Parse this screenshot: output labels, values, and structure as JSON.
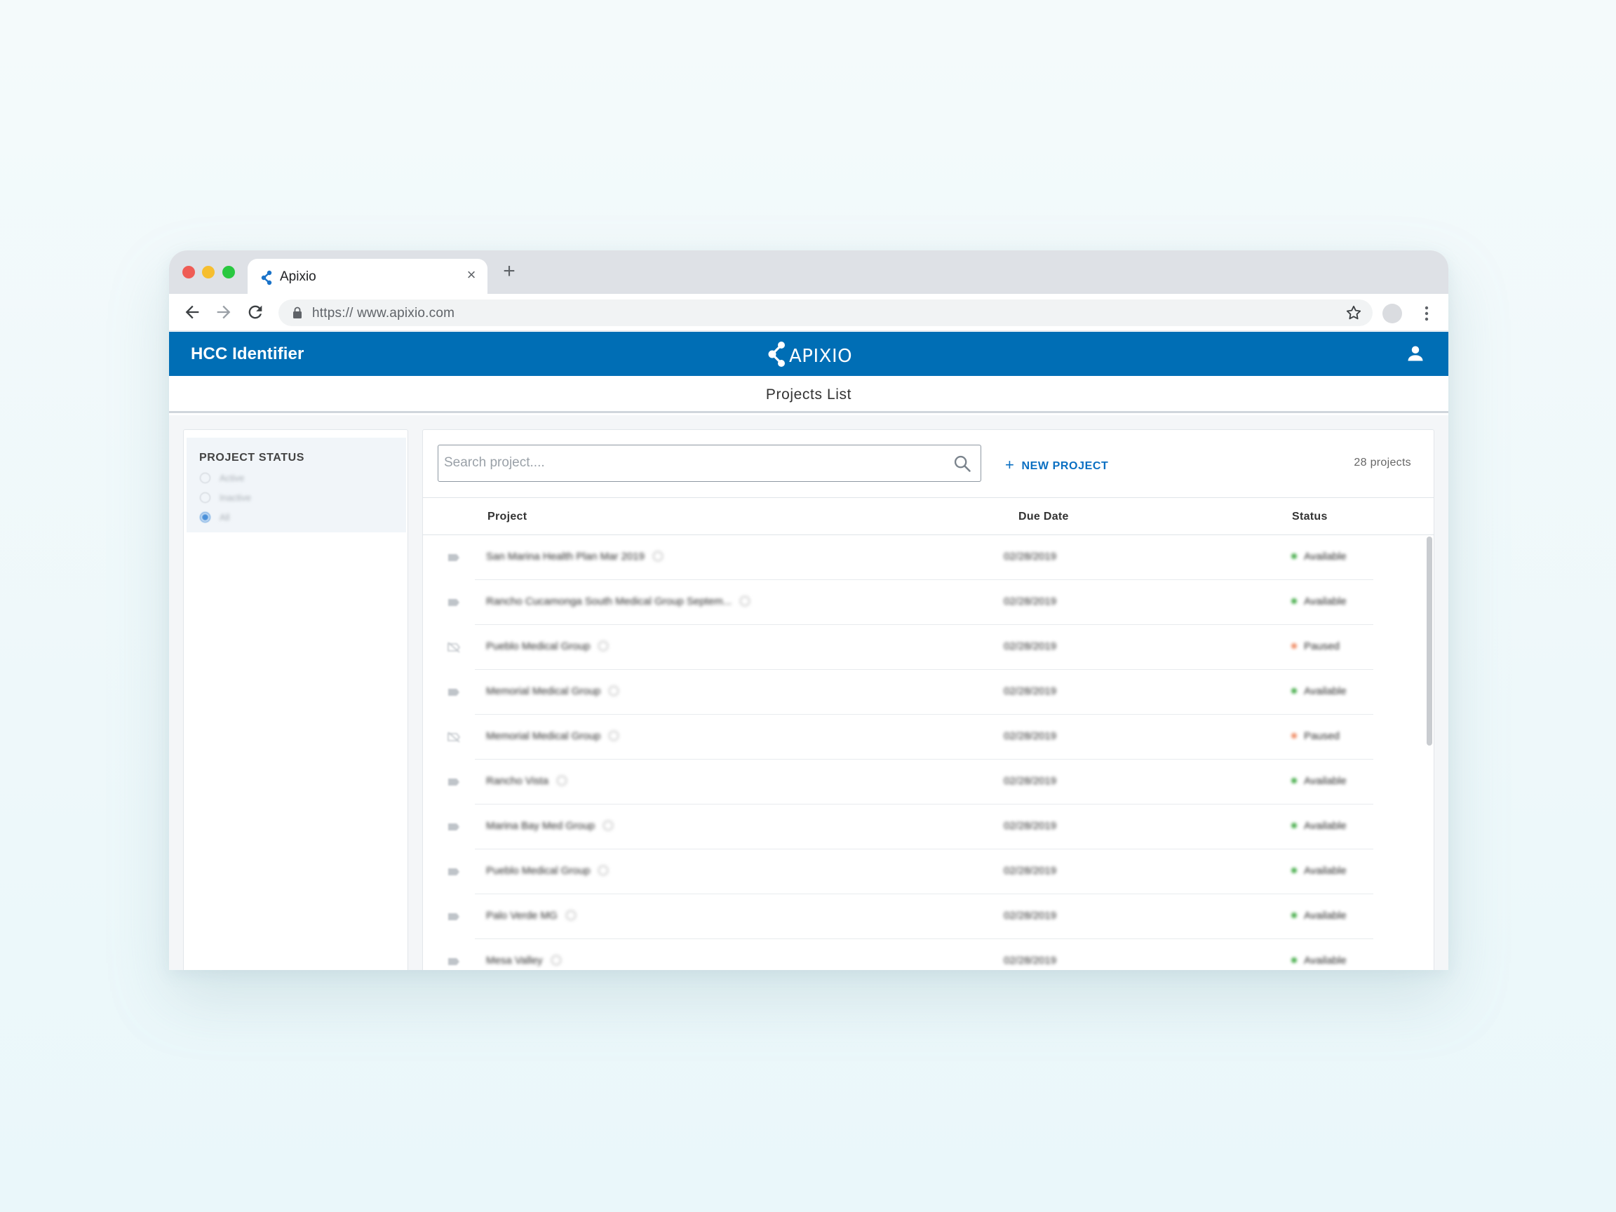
{
  "browser": {
    "tab_title": "Apixio",
    "tab_close": "×",
    "new_tab": "+",
    "url": "https:// www.apixio.com"
  },
  "app": {
    "name": "HCC Identifier",
    "logo_text": "APIXIO",
    "page_title": "Projects List"
  },
  "filters": {
    "heading": "PROJECT STATUS",
    "options": [
      {
        "label": "Active",
        "checked": false
      },
      {
        "label": "Inactive",
        "checked": false
      },
      {
        "label": "All",
        "checked": true
      }
    ]
  },
  "search": {
    "placeholder": "Search project...."
  },
  "actions": {
    "new_project_icon": "+",
    "new_project_label": "NEW PROJECT"
  },
  "project_count": "28 projects",
  "table": {
    "columns": [
      "Project",
      "Due Date",
      "Status"
    ],
    "rows": [
      {
        "name": "San Marina Health Plan Mar 2019",
        "due": "02/28/2019",
        "status": "Available",
        "icon": "tag-icon"
      },
      {
        "name": "Rancho Cucamonga South Medical Group Septem...",
        "due": "02/28/2019",
        "status": "Available",
        "icon": "tag-icon"
      },
      {
        "name": "Pueblo Medical Group",
        "due": "02/28/2019",
        "status": "Paused",
        "icon": "tag-off-icon"
      },
      {
        "name": "Memorial Medical Group",
        "due": "02/28/2019",
        "status": "Available",
        "icon": "tag-icon"
      },
      {
        "name": "Memorial Medical Group",
        "due": "02/28/2019",
        "status": "Paused",
        "icon": "tag-off-icon"
      },
      {
        "name": "Rancho Vista",
        "due": "02/28/2019",
        "status": "Available",
        "icon": "tag-icon"
      },
      {
        "name": "Marina Bay Med Group",
        "due": "02/28/2019",
        "status": "Available",
        "icon": "tag-icon"
      },
      {
        "name": "Pueblo Medical Group",
        "due": "02/28/2019",
        "status": "Available",
        "icon": "tag-icon"
      },
      {
        "name": "Palo Verde MG",
        "due": "02/28/2019",
        "status": "Available",
        "icon": "tag-icon"
      },
      {
        "name": "Mesa Valley",
        "due": "02/28/2019",
        "status": "Available",
        "icon": "tag-icon"
      }
    ]
  },
  "colors": {
    "brand_blue": "#006eb5",
    "link_blue": "#0a6fc2",
    "status_available": "#4caf50",
    "status_paused": "#f0906a"
  }
}
